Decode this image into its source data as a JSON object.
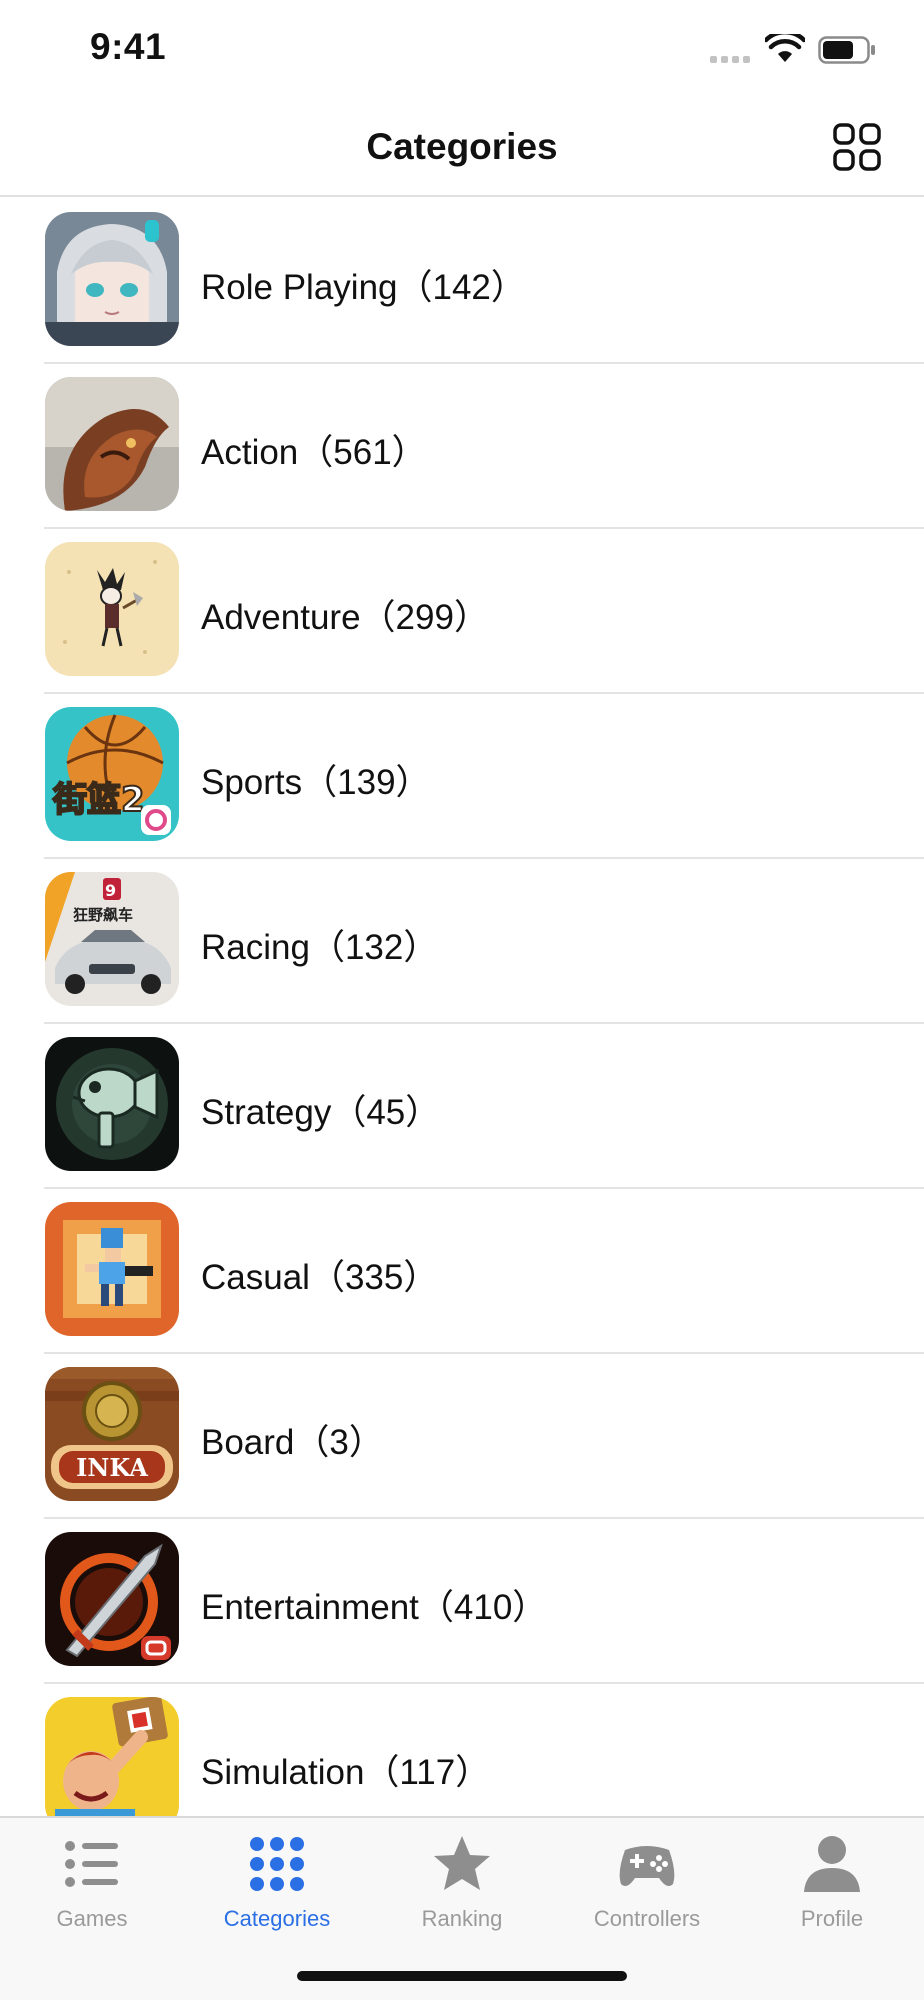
{
  "status_bar": {
    "time": "9:41"
  },
  "nav": {
    "title": "Categories",
    "grid_icon": "grid-view-icon"
  },
  "categories": [
    {
      "label": "Role Playing（142）",
      "icon": "role-playing-app-icon"
    },
    {
      "label": "Action（561）",
      "icon": "action-app-icon"
    },
    {
      "label": "Adventure（299）",
      "icon": "adventure-app-icon"
    },
    {
      "label": "Sports（139）",
      "icon": "sports-app-icon",
      "icon_text": "街篮2"
    },
    {
      "label": "Racing（132）",
      "icon": "racing-app-icon",
      "icon_text": "狂野飙车"
    },
    {
      "label": "Strategy（45）",
      "icon": "strategy-app-icon"
    },
    {
      "label": "Casual（335）",
      "icon": "casual-app-icon"
    },
    {
      "label": "Board（3）",
      "icon": "board-app-icon",
      "icon_text": "INKA"
    },
    {
      "label": "Entertainment（410）",
      "icon": "entertainment-app-icon"
    },
    {
      "label": "Simulation（117）",
      "icon": "simulation-app-icon"
    }
  ],
  "tabs": [
    {
      "label": "Games",
      "icon": "list-icon",
      "active": false
    },
    {
      "label": "Categories",
      "icon": "dots-grid-icon",
      "active": true
    },
    {
      "label": "Ranking",
      "icon": "star-icon",
      "active": false
    },
    {
      "label": "Controllers",
      "icon": "gamepad-icon",
      "active": false
    },
    {
      "label": "Profile",
      "icon": "person-icon",
      "active": false
    }
  ],
  "colors": {
    "accent": "#2b6fe5",
    "inactive_tab": "#9a9a9a",
    "divider": "#e3e3e3"
  }
}
